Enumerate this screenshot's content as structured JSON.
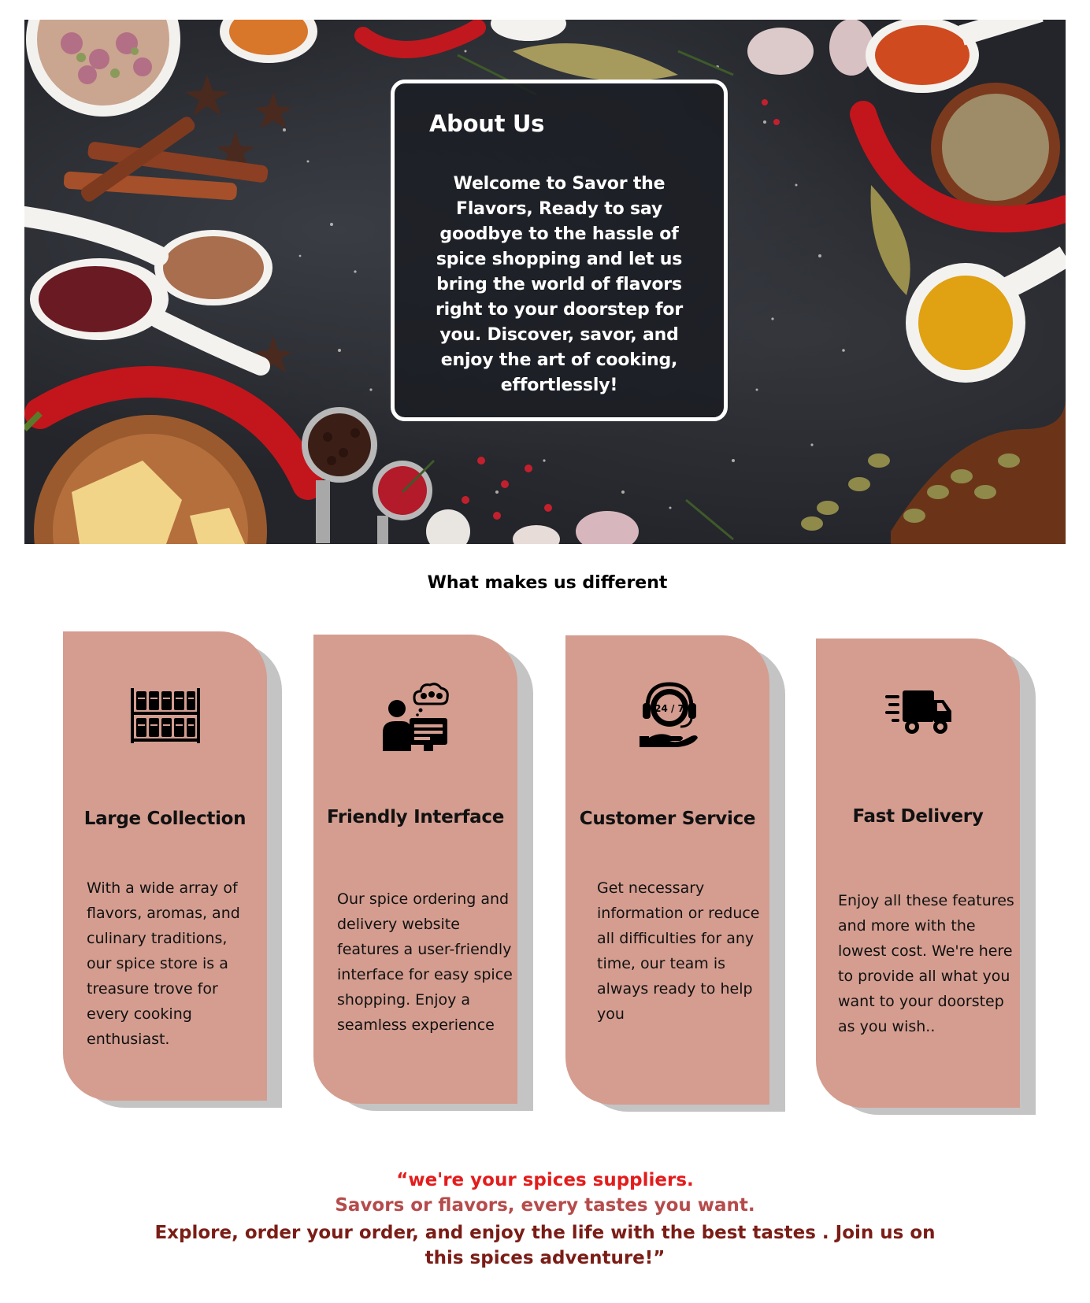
{
  "about": {
    "title": "About Us",
    "text": "Welcome to Savor the Flavors, Ready to say goodbye to the hassle of spice shopping and let us bring the world of flavors right to your doorstep for you. Discover, savor, and enjoy the art of cooking, effortlessly!"
  },
  "features": {
    "heading": "What makes us different",
    "cards": [
      {
        "icon": "spice-rack-icon",
        "title": "Large  Collection",
        "text": " With a wide array of flavors, aromas, and culinary traditions, our spice store is a treasure trove for every cooking enthusiast."
      },
      {
        "icon": "user-computer-icon",
        "title": "Friendly Interface",
        "text": "Our spice ordering and delivery website features a user-friendly interface for easy spice shopping. Enjoy a seamless experience"
      },
      {
        "icon": "support-24-7-icon",
        "icon_label": "24 / 7",
        "title": "Customer Service",
        "text": "Get necessary information or reduce all difficulties for any time, our team is always ready to help you"
      },
      {
        "icon": "delivery-truck-icon",
        "title": "Fast Delivery",
        "text": " Enjoy all these features and more with the lowest cost. We're here to provide all what you want to your doorstep as you wish.."
      }
    ]
  },
  "quote": {
    "line1": "“we're your spices suppliers.",
    "line2": "Savors or flavors, every tastes you want.",
    "line3": "Explore, order your order, and enjoy the life with the best tastes . Join us on this spices adventure!”"
  },
  "colors": {
    "card": "#d49d90",
    "card_shadow": "#c4c4c4",
    "hero_bg": "#23252a",
    "quote_red": "#e31c1c",
    "quote_rose": "#b64b4b",
    "quote_dark": "#7a1d16"
  }
}
